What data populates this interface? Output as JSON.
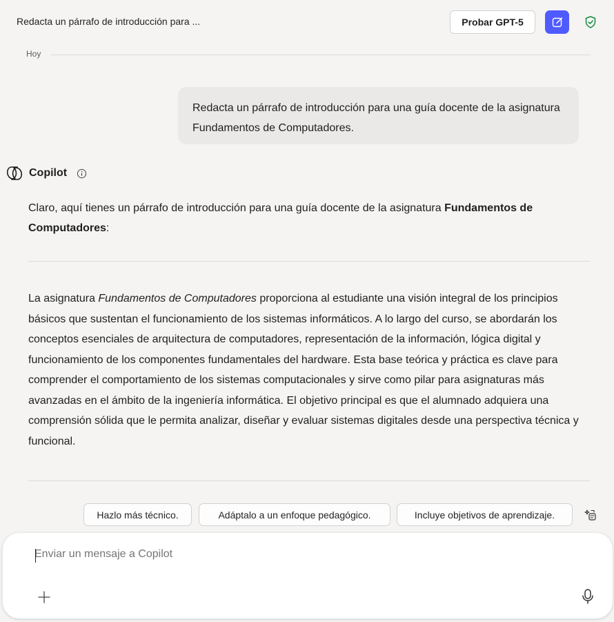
{
  "header": {
    "chat_title": "Redacta un párrafo de introducción para ...",
    "try_model_label": "Probar GPT-5",
    "new_chat_icon": "compose-icon",
    "privacy_icon": "shield-check-icon"
  },
  "timeline": {
    "day_label": "Hoy"
  },
  "user_message": {
    "text": "Redacta un párrafo de introducción para una guía docente de la asignatura Fundamentos de Computadores."
  },
  "assistant": {
    "name": "Copilot",
    "intro_prefix": "Claro, aquí tienes un párrafo de introducción para una guía docente de la asignatura ",
    "intro_bold": "Fundamentos de Computadores",
    "intro_suffix": ":",
    "body_prefix": "La asignatura ",
    "body_italic": "Fundamentos de Computadores",
    "body_rest": " proporciona al estudiante una visión integral de los principios básicos que sustentan el funcionamiento de los sistemas informáticos. A lo largo del curso, se abordarán los conceptos esenciales de arquitectura de computadores, representación de la información, lógica digital y funcionamiento de los componentes fundamentales del hardware. Esta base teórica y práctica es clave para comprender el comportamiento de los sistemas computacionales y sirve como pilar para asignaturas más avanzadas en el ámbito de la ingeniería informática. El objetivo principal es que el alumnado adquiera una comprensión sólida que le permita analizar, diseñar y evaluar sistemas digitales desde una perspectiva técnica y funcional."
  },
  "suggestions": [
    "Hazlo más técnico.",
    "Adáptalo a un enfoque pedagógico.",
    "Incluye objetivos de aprendizaje."
  ],
  "composer": {
    "placeholder": "Enviar un mensaje a Copilot"
  },
  "colors": {
    "accent": "#4f5bff",
    "shield": "#0f8a3a",
    "background": "#f5f4f3"
  }
}
